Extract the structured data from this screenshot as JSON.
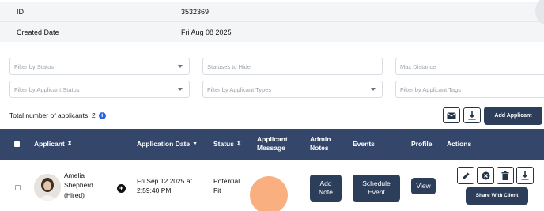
{
  "details": [
    {
      "label": "ID",
      "value": "3532369"
    },
    {
      "label": "Created Date",
      "value": "Fri Aug 08 2025"
    }
  ],
  "filters": {
    "status": "Filter by Status",
    "statuses_to_hide": "Statuses to Hide",
    "max_distance": "Max Distance",
    "applicant_status": "Filter by Applicant Status",
    "applicant_types": "Filter by Applicant Types",
    "applicant_tags": "Filter by Applicant Tags"
  },
  "summary": {
    "total_label": "Total number of applicants: 2",
    "info_icon": "i"
  },
  "toolbar": {
    "add_applicant": "Add Applicant",
    "mail_icon": "mail-icon",
    "download_icon": "download-icon"
  },
  "columns": {
    "applicant": "Applicant",
    "application_date": "Application Date",
    "status": "Status",
    "applicant_message": "Applicant Message",
    "admin_notes": "Admin Notes",
    "events": "Events",
    "profile": "Profile",
    "actions": "Actions"
  },
  "row": {
    "first_name": "Amelia",
    "last_name": "Shepherd",
    "state": "(Hired)",
    "date_line1": "Fri Sep 12 2025 at",
    "date_line2": "2:59:40 PM",
    "status_line1": "Potential",
    "status_line2": "Fit",
    "add_note_line1": "Add",
    "add_note_line2": "Note",
    "schedule_line1": "Schedule",
    "schedule_line2": "Event",
    "view": "View",
    "share": "Share With Client"
  },
  "colors": {
    "header_bg": "#34476b",
    "button_bg": "#2c3e5a",
    "accent_circle": "#f9ab78",
    "info": "#2563eb"
  }
}
